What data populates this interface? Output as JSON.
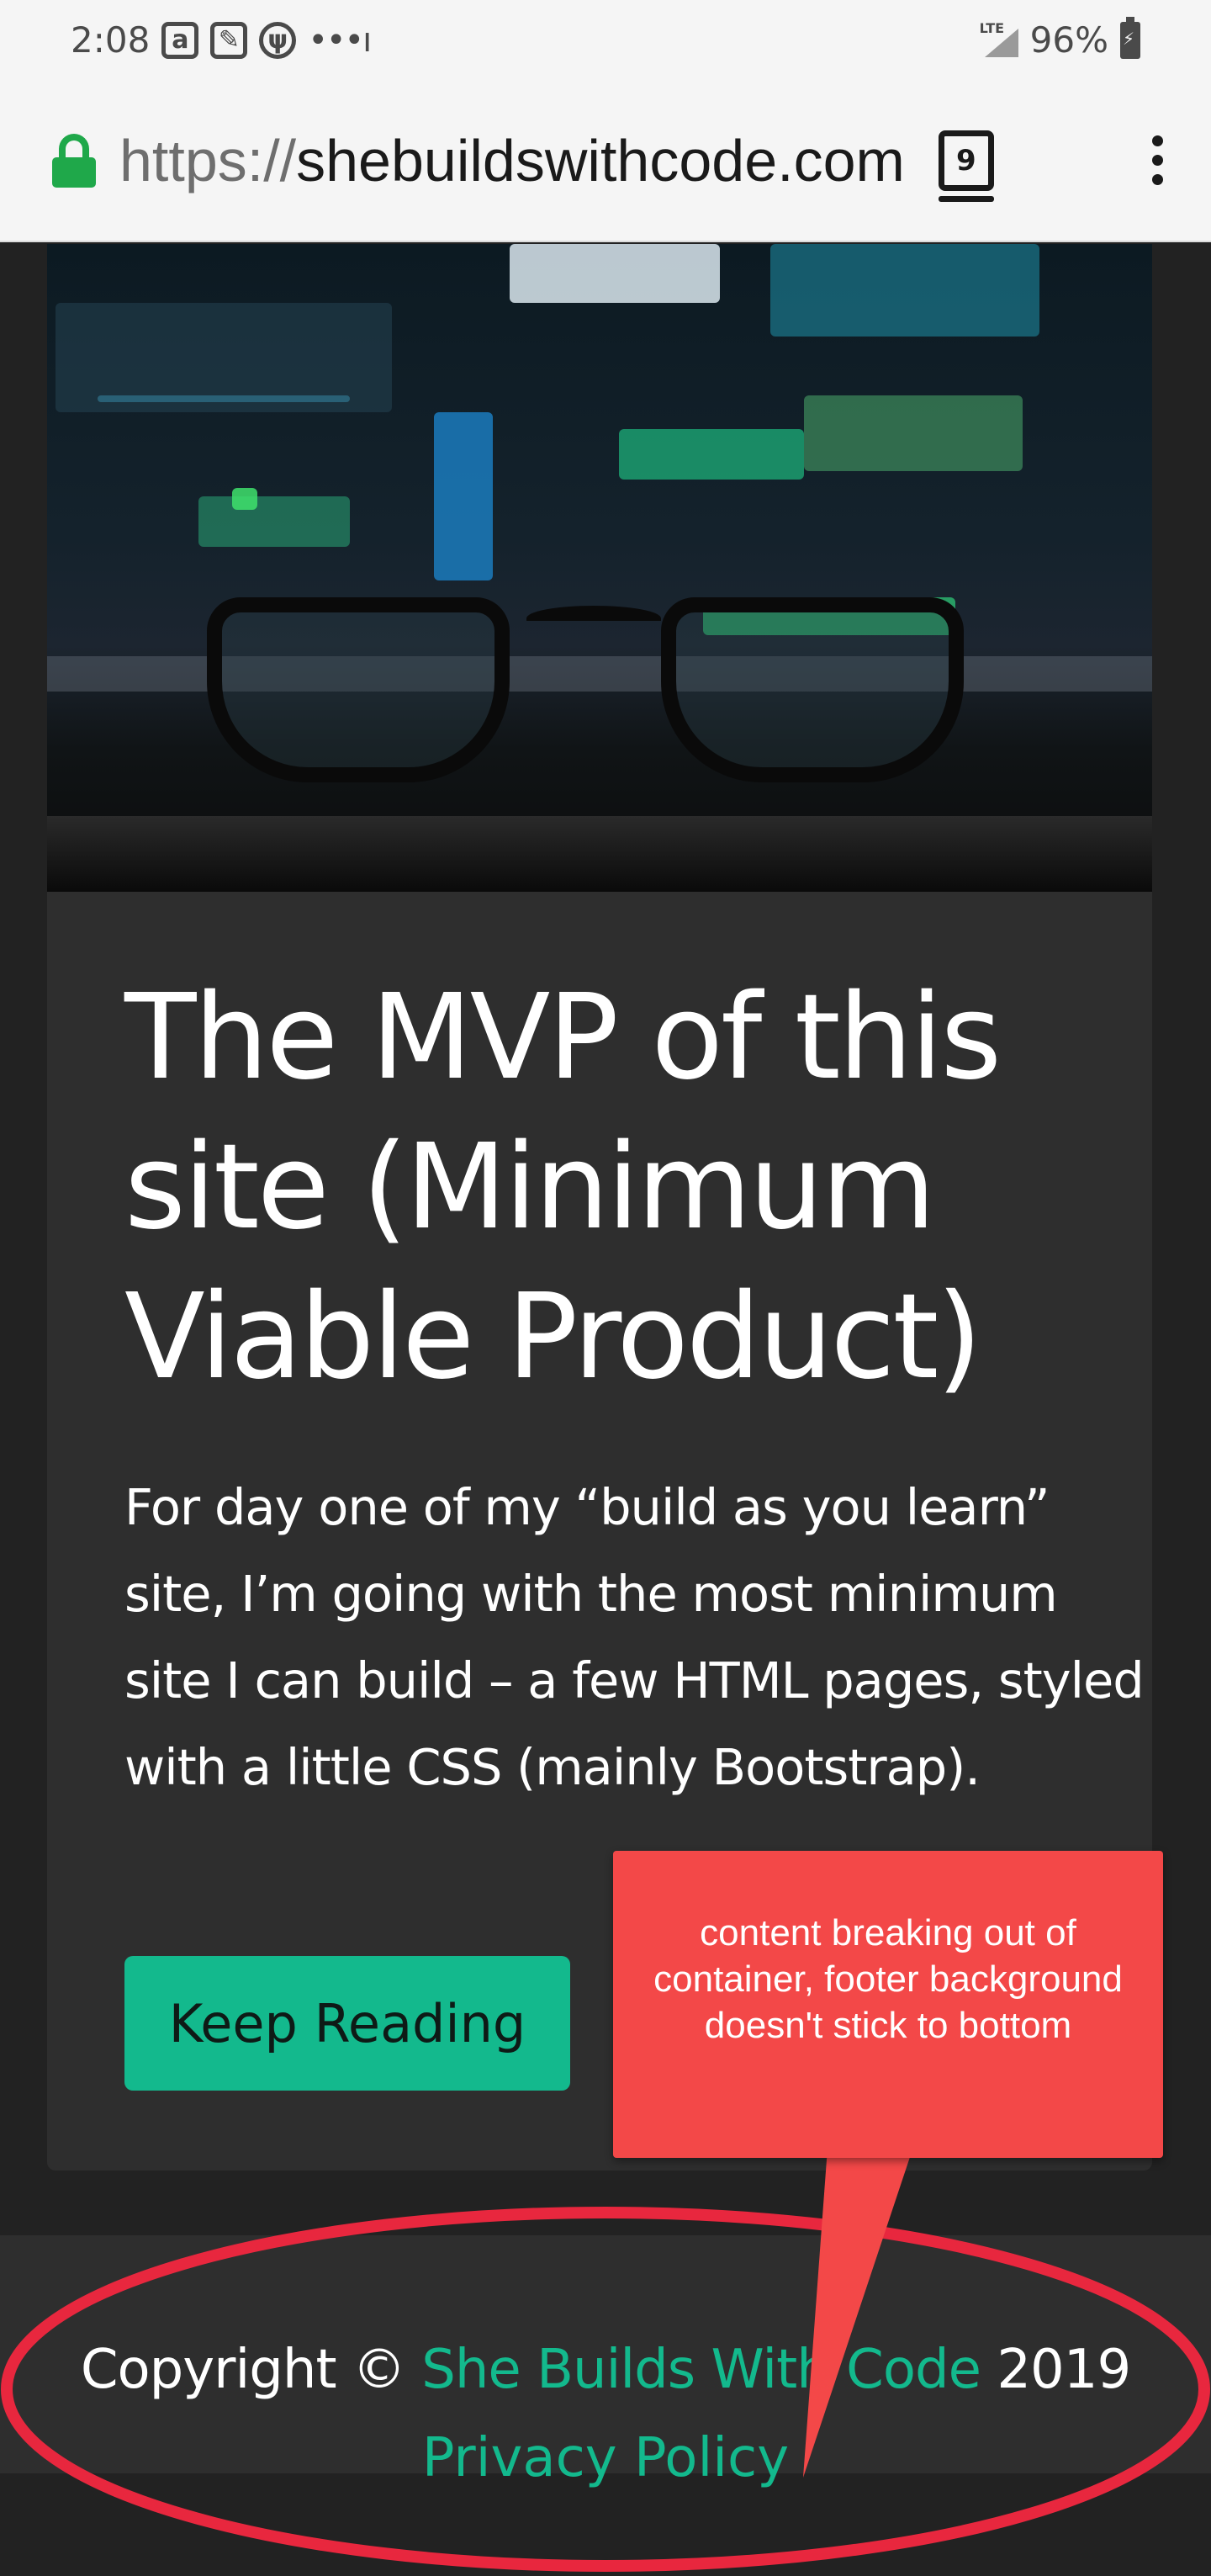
{
  "status_bar": {
    "time": "2:08",
    "notification_icons": [
      "amazon-icon",
      "edit-icon",
      "usb-icon"
    ],
    "more_dots": "•••ı",
    "network": "LTE",
    "battery_percent": "96%"
  },
  "browser": {
    "url_scheme": "https://",
    "url_host": "shebuildswithcode.com",
    "tab_count": "9"
  },
  "post": {
    "title": "The MVP of this site (Minimum Viable Product)",
    "body": "For day one of my “build as you learn” site, I’m going with the most minimum site I can build – a few HTML pages, styled with a little CSS (mainly Bootstrap).",
    "button_label": "Keep Reading"
  },
  "footer": {
    "copyright_prefix": "Copyright © ",
    "brand": "She Builds With Code",
    "year": " 2019",
    "privacy_link": "Privacy Policy"
  },
  "annotation": {
    "text": "content breaking out of container, footer background doesn't stick to bottom",
    "color": "#f34848",
    "ellipse_color": "#e8273e"
  },
  "colors": {
    "accent": "#13b98d",
    "page_background": "#222222",
    "card_background": "#2e2e2e",
    "lock_green": "#1fa84a"
  }
}
